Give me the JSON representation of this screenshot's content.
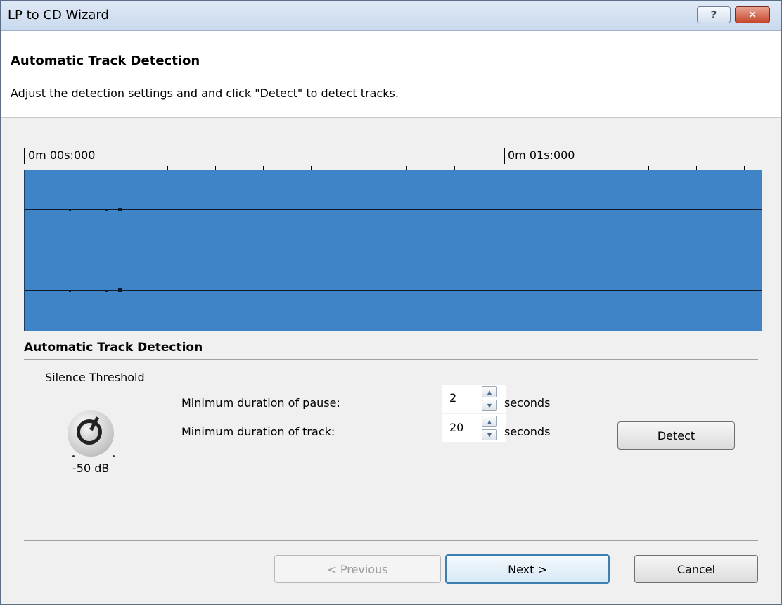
{
  "window": {
    "title": "LP to CD Wizard",
    "help_glyph": "?",
    "close_glyph": "✕"
  },
  "header": {
    "title": "Automatic Track Detection",
    "subtitle": "Adjust the detection settings and and click \"Detect\" to detect tracks."
  },
  "timeline": {
    "label_start": "0m 00s:000",
    "label_mid": "0m 01s:000"
  },
  "section": {
    "title": "Automatic Track Detection",
    "silence_label": "Silence Threshold",
    "knob_value": "-50 dB",
    "pause_label": "Minimum duration of pause:",
    "pause_value": "2",
    "pause_unit": "seconds",
    "track_label": "Minimum duration of track:",
    "track_value": "20",
    "track_unit": "seconds",
    "detect_label": "Detect",
    "spin_up_glyph": "▲",
    "spin_down_glyph": "▼"
  },
  "buttons": {
    "previous": "< Previous",
    "next": "Next >",
    "cancel": "Cancel"
  },
  "colors": {
    "waveform": "#3e84c6",
    "default_button_border": "#3c7fb1"
  }
}
